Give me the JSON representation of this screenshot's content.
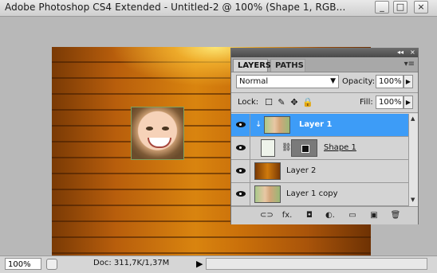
{
  "window": {
    "title": "Adobe Photoshop CS4 Extended - Untitled-2 @ 100% (Shape 1, RGB...",
    "buttons": [
      "_",
      "□",
      "×"
    ]
  },
  "status": {
    "zoom": "100%",
    "doc": "Doc: 311,7K/1,37M",
    "arrow": "▶"
  },
  "panel": {
    "collapse": "◂◂",
    "close": "×",
    "tabs": [
      "LAYERS",
      "PATHS"
    ],
    "menu": "▾≡",
    "blend_mode": "Normal",
    "blend_arrow": "▼",
    "opacity_label": "Opacity:",
    "opacity_value": "100%",
    "lock_label": "Lock:",
    "fill_label": "Fill:",
    "fill_value": "100%",
    "stepper": "▶",
    "lock_icons": [
      "☐",
      "✎",
      "✥",
      "🔒"
    ],
    "layers": [
      {
        "name": "Layer 1",
        "selected": true
      },
      {
        "name": "Shape 1",
        "selected": false
      },
      {
        "name": "Layer 2",
        "selected": false
      },
      {
        "name": "Layer 1 copy",
        "selected": false
      }
    ],
    "chain": "⛓",
    "scroll_up": "▲",
    "scroll_down": "▼",
    "bottom_icons": [
      "link-icon",
      "fx-icon",
      "mask-icon",
      "adjustment-icon",
      "folder-icon",
      "new-layer-icon",
      "trash-icon"
    ],
    "bottom_glyphs": [
      "⊂⊃",
      "fx.",
      "◘",
      "◐.",
      "▭",
      "▣",
      "🗑"
    ]
  }
}
